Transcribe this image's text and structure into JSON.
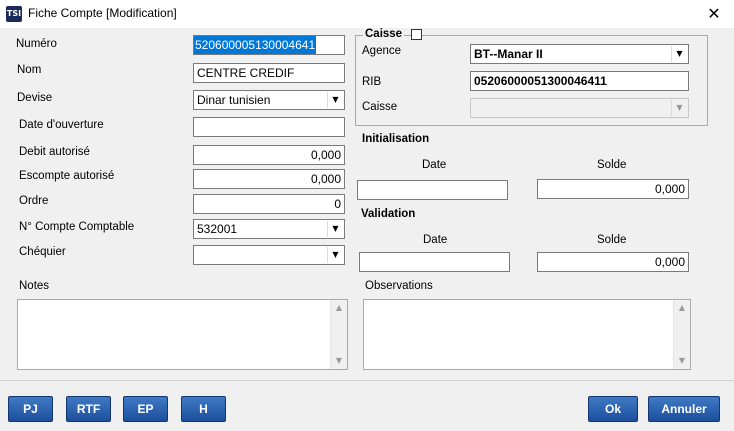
{
  "window": {
    "title": "Fiche Compte [Modification]",
    "icon": "app-logo-icon",
    "close_label": "✕"
  },
  "fields": {
    "numero": {
      "label": "Numéro",
      "value": "520600005130004641"
    },
    "nom": {
      "label": "Nom",
      "value": "CENTRE CREDIF"
    },
    "devise": {
      "label": "Devise",
      "value": "Dinar tunisien"
    },
    "date_ouverture": {
      "label": "Date d'ouverture",
      "value": ""
    },
    "debit_autorise": {
      "label": "Debit autorisé",
      "value": "0,000"
    },
    "escompte_autorise": {
      "label": "Escompte autorisé",
      "value": "0,000"
    },
    "ordre": {
      "label": "Ordre",
      "value": "0"
    },
    "compte_comptable": {
      "label": "N° Compte Comptable",
      "value": "532001"
    },
    "chequier": {
      "label": "Chéquier",
      "value": ""
    }
  },
  "caisse_group": {
    "title": "Caisse",
    "checked": false,
    "agence": {
      "label": "Agence",
      "value": "BT--Manar II"
    },
    "rib": {
      "label": "RIB",
      "value": "05206000051300046411"
    },
    "caisse": {
      "label": "Caisse",
      "value": ""
    }
  },
  "initialisation": {
    "title": "Initialisation",
    "date_label": "Date",
    "date_value": "",
    "solde_label": "Solde",
    "solde_value": "0,000"
  },
  "validation": {
    "title": "Validation",
    "date_label": "Date",
    "date_value": "",
    "solde_label": "Solde",
    "solde_value": "0,000"
  },
  "notes": {
    "label": "Notes",
    "value": ""
  },
  "observations": {
    "label": "Observations",
    "value": ""
  },
  "buttons": {
    "pj": "PJ",
    "rtf": "RTF",
    "ep": "EP",
    "h": "H",
    "ok": "Ok",
    "annuler": "Annuler"
  },
  "colors": {
    "accent": "#2a63b3",
    "selection": "#0078d7",
    "group_border": "#7eb4ea"
  }
}
